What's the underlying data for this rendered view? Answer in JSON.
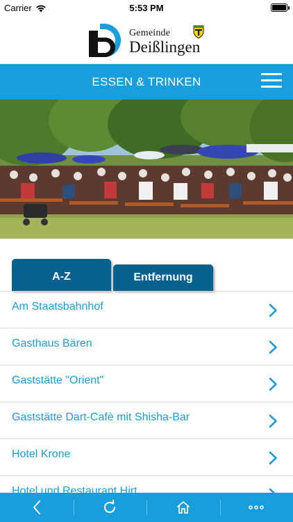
{
  "status_bar": {
    "carrier": "Carrier",
    "time": "5:53 PM"
  },
  "logo": {
    "line1": "Gemeinde",
    "line2": "Deißlingen",
    "crest_colors": [
      "#f2d11c",
      "#1b1b1b",
      "#3d8b2a"
    ]
  },
  "header": {
    "title": "ESSEN & TRINKEN",
    "menu_icon": "hamburger-menu-icon",
    "background": "#1a9ddb"
  },
  "hero_image": {
    "subject": "beer-garden-crowd-under-parasols"
  },
  "tabs": [
    {
      "label": "A-Z",
      "active": true
    },
    {
      "label": "Entfernung",
      "active": false
    }
  ],
  "list": {
    "items": [
      {
        "label": "Am Staatsbahnhof"
      },
      {
        "label": "Gasthaus Bären"
      },
      {
        "label": "Gaststätte \"Orient\""
      },
      {
        "label": "Gaststätte Dart-Cafè mit Shisha-Bar"
      },
      {
        "label": "Hotel Krone"
      },
      {
        "label": "Hotel und Restaurant Hirt"
      }
    ],
    "chevron_icon": "chevron-right-icon",
    "text_color": "#1a9ddb"
  },
  "toolbar": {
    "buttons": [
      {
        "icon": "back-icon"
      },
      {
        "icon": "refresh-icon"
      },
      {
        "icon": "home-icon"
      },
      {
        "icon": "more-icon"
      }
    ]
  }
}
